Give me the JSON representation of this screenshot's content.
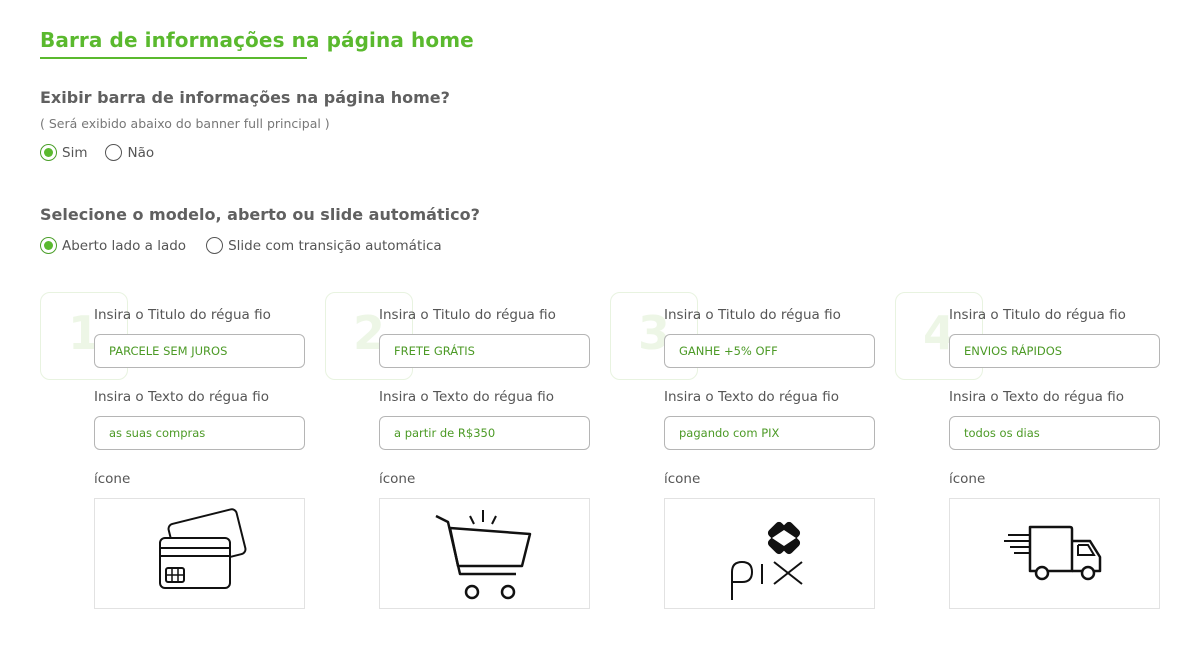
{
  "section": {
    "title": "Barra de informações na página home"
  },
  "show_bar": {
    "question": "Exibir barra de informações na página home?",
    "hint": "( Será exibido abaixo do banner full principal )",
    "options": [
      {
        "label": "Sim",
        "checked": true
      },
      {
        "label": "Não",
        "checked": false
      }
    ]
  },
  "model": {
    "question": "Selecione o modelo, aberto ou slide automático?",
    "options": [
      {
        "label": "Aberto lado a lado",
        "checked": true
      },
      {
        "label": "Slide com transição automática",
        "checked": false
      }
    ]
  },
  "cards": [
    {
      "number": "1",
      "title_label": "Insira o Titulo do régua fio",
      "title_value": "PARCELE SEM JUROS",
      "text_label": "Insira o Texto do régua fio",
      "text_value": "as suas compras",
      "icon_label": "ícone",
      "icon": "credit-card-icon"
    },
    {
      "number": "2",
      "title_label": "Insira o Titulo do régua fio",
      "title_value": "FRETE GRÁTIS",
      "text_label": "Insira o Texto do régua fio",
      "text_value": "a partir de R$350",
      "icon_label": "ícone",
      "icon": "shopping-cart-icon"
    },
    {
      "number": "3",
      "title_label": "Insira o Titulo do régua fio",
      "title_value": "GANHE +5% OFF",
      "text_label": "Insira o Texto do régua fio",
      "text_value": "pagando com PIX",
      "icon_label": "ícone",
      "icon": "pix-logo-icon"
    },
    {
      "number": "4",
      "title_label": "Insira o Titulo do régua fio",
      "title_value": "ENVIOS RÁPIDOS",
      "text_label": "Insira o Texto do régua fio",
      "text_value": "todos os dias",
      "icon_label": "ícone",
      "icon": "delivery-truck-icon"
    }
  ],
  "colors": {
    "accent": "#5ab92e",
    "input_text": "#4c9a26",
    "number_watermark": "#edf6e6"
  }
}
